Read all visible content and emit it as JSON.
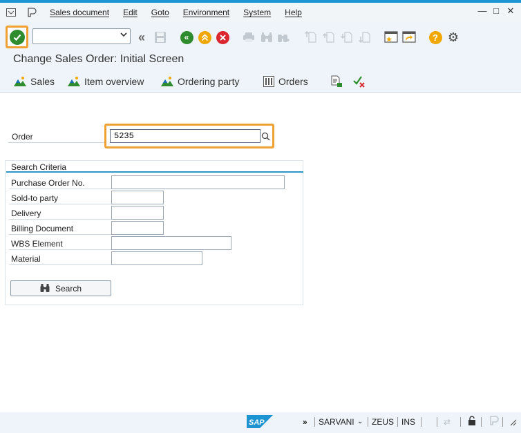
{
  "menubar": {
    "items": [
      {
        "label": "Sales document"
      },
      {
        "label": "Edit"
      },
      {
        "label": "Goto"
      },
      {
        "label": "Environment"
      },
      {
        "label": "System"
      },
      {
        "label": "Help"
      }
    ]
  },
  "toolbar": {
    "command_field_value": ""
  },
  "page": {
    "title": "Change Sales Order: Initial Screen"
  },
  "app_toolbar": {
    "sales": "Sales",
    "item_overview": "Item overview",
    "ordering_party": "Ordering party",
    "orders": "Orders"
  },
  "order": {
    "label": "Order",
    "value": "5235"
  },
  "search_criteria": {
    "title": "Search Criteria",
    "fields": [
      {
        "label": "Purchase Order No.",
        "value": ""
      },
      {
        "label": "Sold-to party",
        "value": ""
      },
      {
        "label": "Delivery",
        "value": ""
      },
      {
        "label": "Billing Document",
        "value": ""
      },
      {
        "label": "WBS Element",
        "value": ""
      },
      {
        "label": "Material",
        "value": ""
      }
    ],
    "search_button": "Search"
  },
  "statusbar": {
    "logo": "SAP",
    "user": "SARVANI",
    "system": "ZEUS",
    "mode": "INS"
  },
  "colors": {
    "accent": "#1c94d2",
    "highlight": "#f0a030",
    "enter_green": "#2e8b2e",
    "cancel_red": "#d9262f",
    "exit_yellow": "#f0a800"
  }
}
